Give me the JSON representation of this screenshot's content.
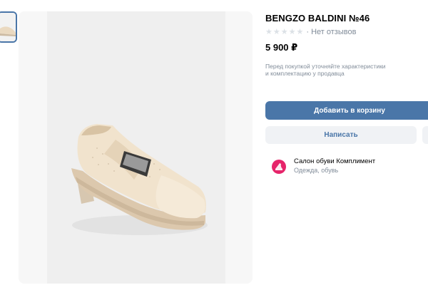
{
  "product": {
    "title": "BENGZO BALDINI №46",
    "rating": {
      "stars_filled": 0,
      "stars_total": 5,
      "reviews_text": "· Нет отзывов"
    },
    "price": "5 900 ₽",
    "note_line1": "Перед покупкой уточняйте характеристики",
    "note_line2": "и комплектацию у продавца"
  },
  "actions": {
    "add_to_cart": "Добавить в корзину",
    "write": "Написать"
  },
  "seller": {
    "name": "Салон обуви Комплимент",
    "category": "Одежда, обувь"
  },
  "colors": {
    "accent": "#4a76a8",
    "secondary_bg": "#f0f2f5",
    "muted_text": "#818c99",
    "avatar": "#e6246a"
  },
  "icons": {
    "star": "star-icon",
    "seller_avatar": "shoe-logo-icon"
  }
}
